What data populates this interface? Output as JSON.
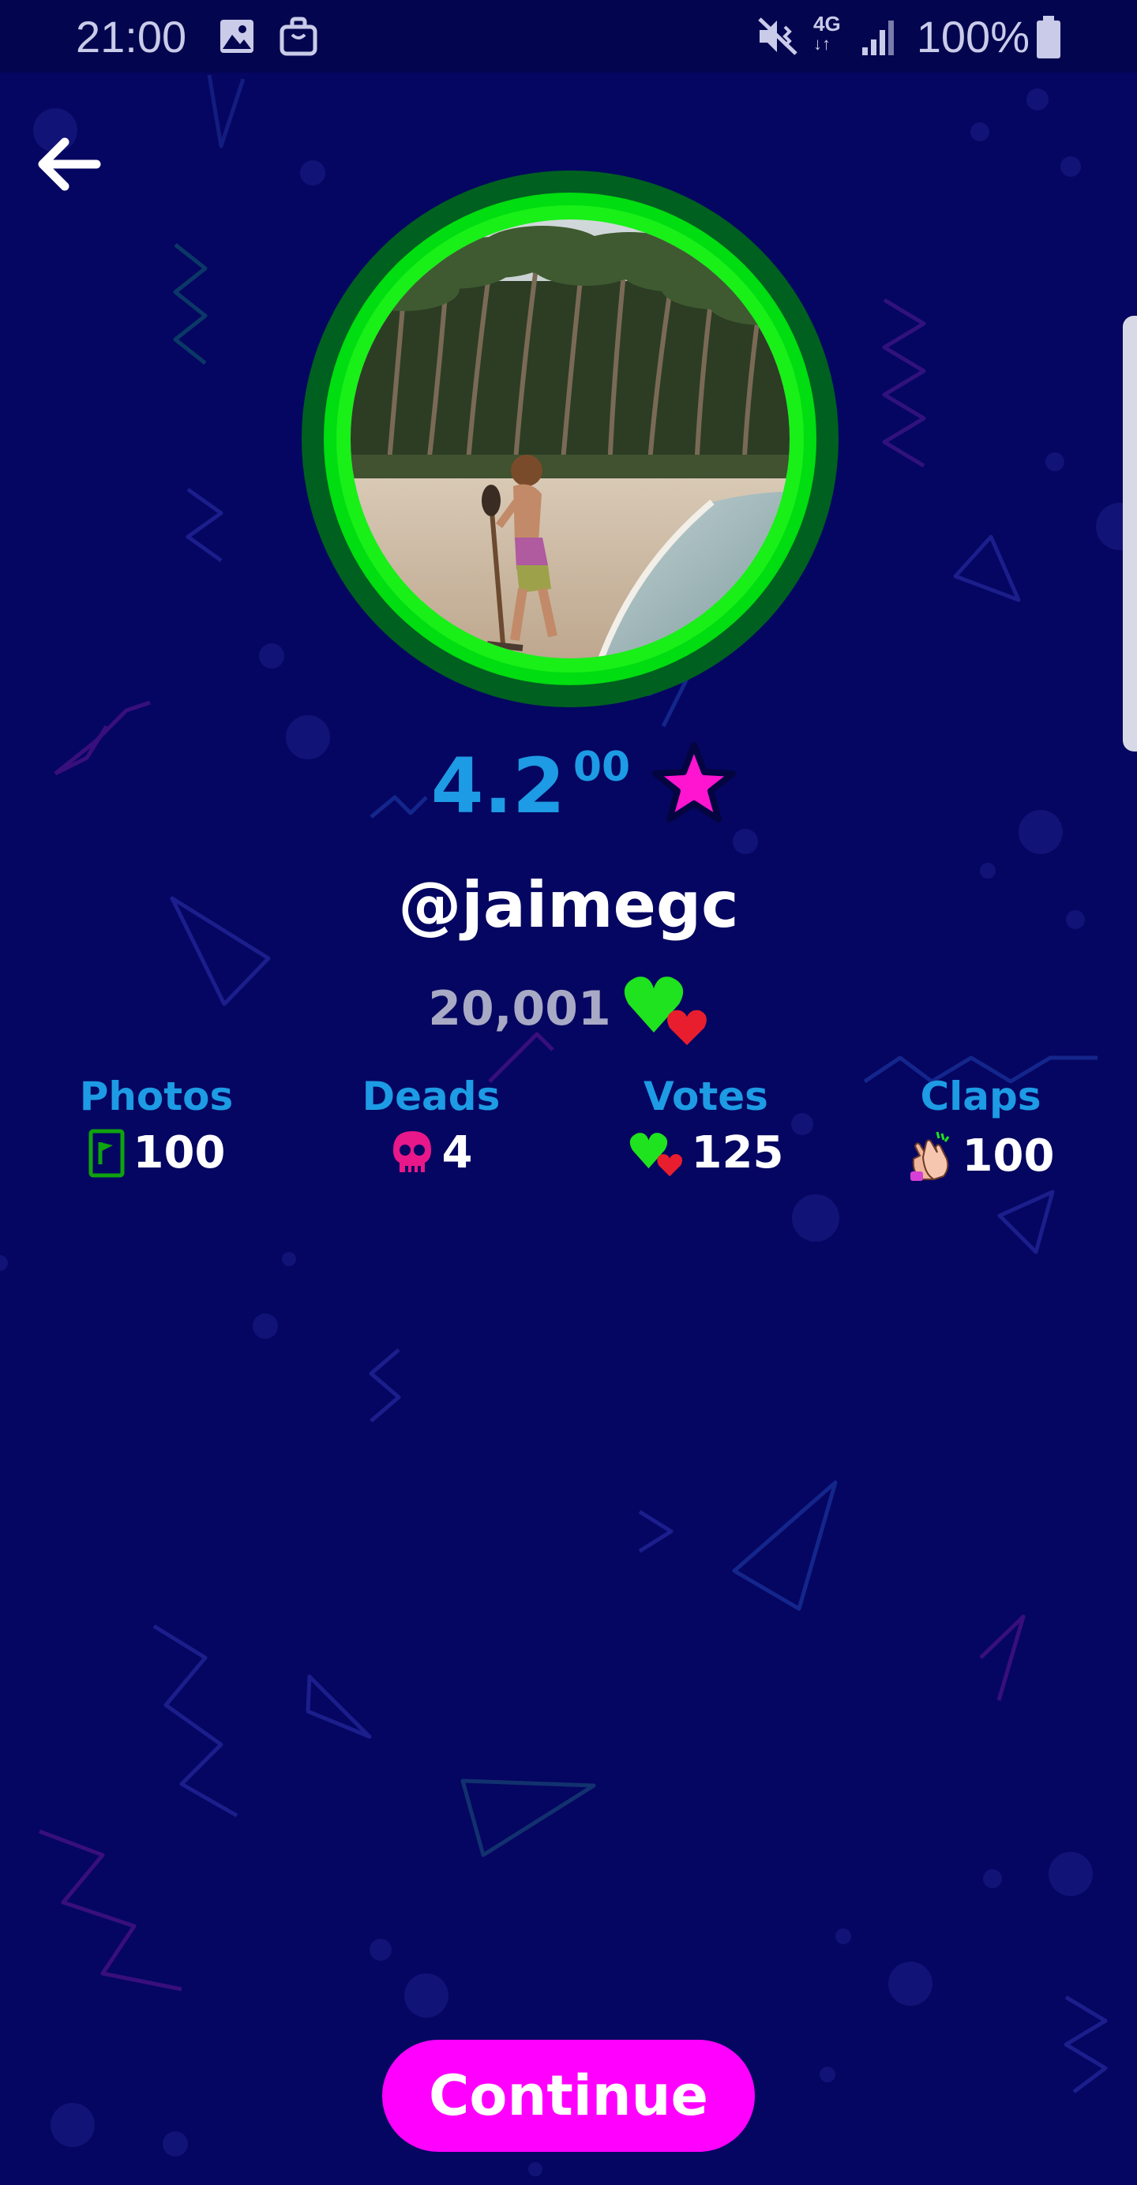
{
  "status_bar": {
    "time": "21:00",
    "network": "4G",
    "battery": "100%",
    "icons": [
      "image-icon",
      "shopping-bag-icon",
      "mute-vibrate-icon",
      "4g-data-icon",
      "signal-icon",
      "battery-icon"
    ]
  },
  "nav": {
    "back_icon": "arrow-left-icon"
  },
  "profile": {
    "avatar_icon": "profile-photo",
    "rating_integer": "4.2",
    "rating_decimal": "00",
    "rating_icon": "star-icon",
    "username": "@jaimegc",
    "points": "20,001",
    "points_icon": "hearts-icon"
  },
  "stats": [
    {
      "label": "Photos",
      "value": "100",
      "icon": "photo-flag-icon"
    },
    {
      "label": "Deads",
      "value": "4",
      "icon": "skull-icon"
    },
    {
      "label": "Votes",
      "value": "125",
      "icon": "hearts-icon"
    },
    {
      "label": "Claps",
      "value": "100",
      "icon": "clapping-hands-icon"
    }
  ],
  "continue_label": "Continue",
  "colors": {
    "background": "#050661",
    "accent_blue": "#1d9be4",
    "ring_green": "#1fe31f",
    "button_magenta": "#ff00ff",
    "star_magenta": "#ff14d0"
  }
}
